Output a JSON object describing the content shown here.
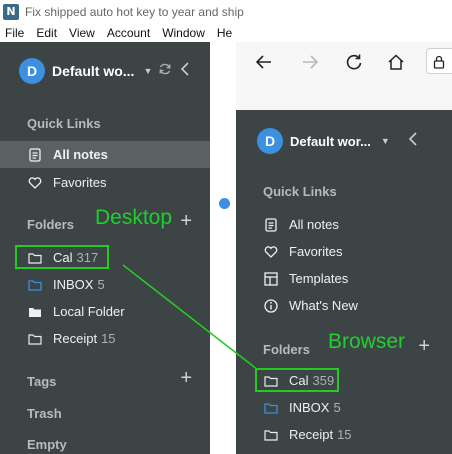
{
  "window": {
    "app_icon_letter": "N",
    "title": "Fix shipped auto hot key to year and ship"
  },
  "menubar": [
    "File",
    "Edit",
    "View",
    "Account",
    "Window",
    "He"
  ],
  "desktop": {
    "account": {
      "initial": "D",
      "name": "Default wo..."
    },
    "quick_links_label": "Quick Links",
    "all_notes": "All notes",
    "favorites": "Favorites",
    "folders_label": "Folders",
    "folders": [
      {
        "name": "Cal",
        "count": "317"
      },
      {
        "name": "INBOX",
        "count": "5"
      },
      {
        "name": "Local Folder",
        "count": ""
      },
      {
        "name": "Receipt",
        "count": "15"
      }
    ],
    "tags_label": "Tags",
    "trash_label": "Trash",
    "empty_label": "Empty"
  },
  "browser": {
    "account": {
      "initial": "D",
      "name": "Default wor..."
    },
    "quick_links_label": "Quick Links",
    "nav": [
      "All notes",
      "Favorites",
      "Templates",
      "What's New"
    ],
    "folders_label": "Folders",
    "folders": [
      {
        "name": "Cal",
        "count": "359"
      },
      {
        "name": "INBOX",
        "count": "5"
      },
      {
        "name": "Receipt",
        "count": "15"
      }
    ]
  },
  "annotations": {
    "desktop_label": "Desktop",
    "browser_label": "Browser"
  },
  "colors": {
    "sidebar_bg": "#3d4446",
    "accent_blue": "#3d8fe0",
    "annotation_green": "#22cc22"
  }
}
